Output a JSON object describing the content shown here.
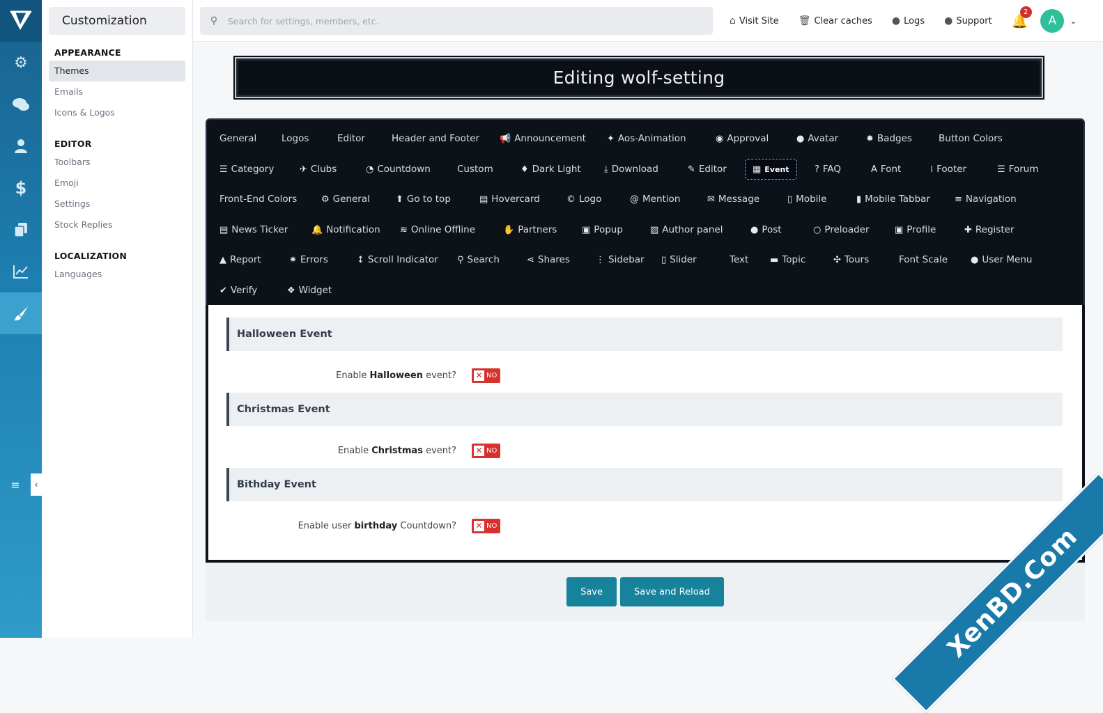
{
  "rail": {
    "icons": [
      "logo-icon",
      "gear-icon",
      "chat-icon",
      "user-icon",
      "dollar-icon",
      "copy-icon",
      "chart-icon",
      "brush-icon"
    ]
  },
  "sidebar": {
    "title": "Customization",
    "sections": [
      {
        "title": "APPEARANCE",
        "items": [
          "Themes",
          "Emails",
          "Icons & Logos"
        ]
      },
      {
        "title": "EDITOR",
        "items": [
          "Toolbars",
          "Emoji",
          "Settings",
          "Stock Replies"
        ]
      },
      {
        "title": "LOCALIZATION",
        "items": [
          "Languages"
        ]
      }
    ]
  },
  "topbar": {
    "search_placeholder": "Search for settings, members, etc.",
    "visit_site": "Visit Site",
    "clear_caches": "Clear caches",
    "logs": "Logs",
    "support": "Support",
    "notification_count": "2",
    "avatar_letter": "A"
  },
  "page": {
    "title": "Editing wolf-setting"
  },
  "tabs": [
    [
      "General",
      "Logos",
      "Editor",
      "Header and Footer",
      "Announcement",
      "Aos-Animation",
      "Approval",
      "Avatar",
      "Badges",
      "Button Colors"
    ],
    [
      "Category",
      "Clubs",
      "Countdown",
      "Custom",
      "Dark Light",
      "Download",
      "Editor",
      "Event",
      "FAQ",
      "Font",
      "Footer",
      "Forum"
    ],
    [
      "Front-End Colors",
      "General",
      "Go to top",
      "Hovercard",
      "Logo",
      "Mention",
      "Message",
      "Mobile",
      "Mobile Tabbar",
      "Navigation"
    ],
    [
      "News Ticker",
      "Notification",
      "Online Offline",
      "Partners",
      "Popup",
      "Author panel",
      "Post",
      "Preloader",
      "Profile",
      "Register"
    ],
    [
      "Report",
      "Errors",
      "Scroll Indicator",
      "Search",
      "Shares",
      "Sidebar",
      "Slider",
      "Text",
      "Topic",
      "Tours",
      "Font Scale",
      "User Menu"
    ],
    [
      "Verify",
      "Widget"
    ]
  ],
  "active_tab": "Event",
  "events": [
    {
      "heading": "Halloween Event",
      "label_pre": "Enable ",
      "label_bold": "Halloween",
      "label_post": " event?",
      "value": "NO"
    },
    {
      "heading": "Christmas Event",
      "label_pre": "Enable ",
      "label_bold": "Christmas",
      "label_post": " event?",
      "value": "NO"
    },
    {
      "heading": "Bithday Event",
      "label_pre": "Enable user ",
      "label_bold": "birthday",
      "label_post": " Countdown?",
      "value": "NO"
    }
  ],
  "buttons": {
    "save": "Save",
    "save_reload": "Save and Reload"
  },
  "ribbon_text": "XenBD.Com"
}
